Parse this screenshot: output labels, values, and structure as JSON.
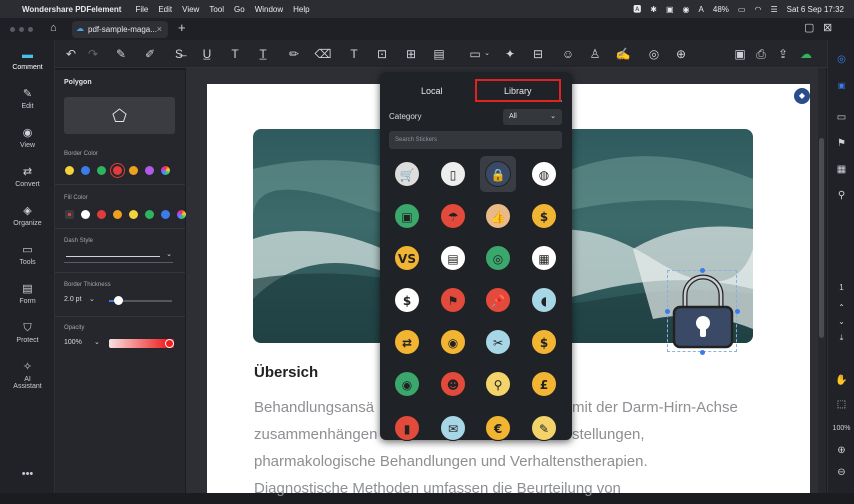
{
  "menubar": {
    "app": "Wondershare PDFelement",
    "items": [
      "File",
      "Edit",
      "View",
      "Tool",
      "Go",
      "Window",
      "Help"
    ],
    "battery": "48%",
    "datetime": "Sat 6 Sep  17:32"
  },
  "tab": {
    "title": "pdf-sample-maga..."
  },
  "leftnav": [
    "Comment",
    "Edit",
    "View",
    "Convert",
    "Organize",
    "Tools",
    "Form",
    "Protect",
    "AI Assistant"
  ],
  "props": {
    "title": "Polygon",
    "border_color": "Border Color",
    "fill_color": "Fill Color",
    "dash_style": "Dash Style",
    "border_thickness": "Border Thickness",
    "thickness_value": "2.0 pt",
    "opacity": "Opacity",
    "opacity_value": "100%",
    "border_colors": [
      "#f3d33b",
      "#3b7bea",
      "#2fb35c",
      "#e23b3b",
      "#f0a020",
      "#b25ae8",
      "#d8d8d8"
    ],
    "fill_colors": [
      "#e23b3b",
      "#ffffff",
      "#e23b3b",
      "#f0a020",
      "#f3d33b",
      "#2fb35c",
      "#3b7bea",
      "#d8d8d8"
    ]
  },
  "document": {
    "heading": "Übersich",
    "lines": [
      "Behandlungsansä",
      "zusammenhängen",
      "pharmakologische Behandlungen und Verhaltenstherapien.",
      "Diagnostische Methoden umfassen die Beurteilung von"
    ],
    "right_lines": [
      "mit der Darm-Hirn-Achse",
      "stellungen,"
    ]
  },
  "stickers": {
    "tabs": [
      "Local",
      "Library"
    ],
    "category_label": "Category",
    "category_value": "All",
    "search_placeholder": "Search Stickers"
  },
  "rightbar": {
    "page": "1",
    "zoom": "100%"
  }
}
